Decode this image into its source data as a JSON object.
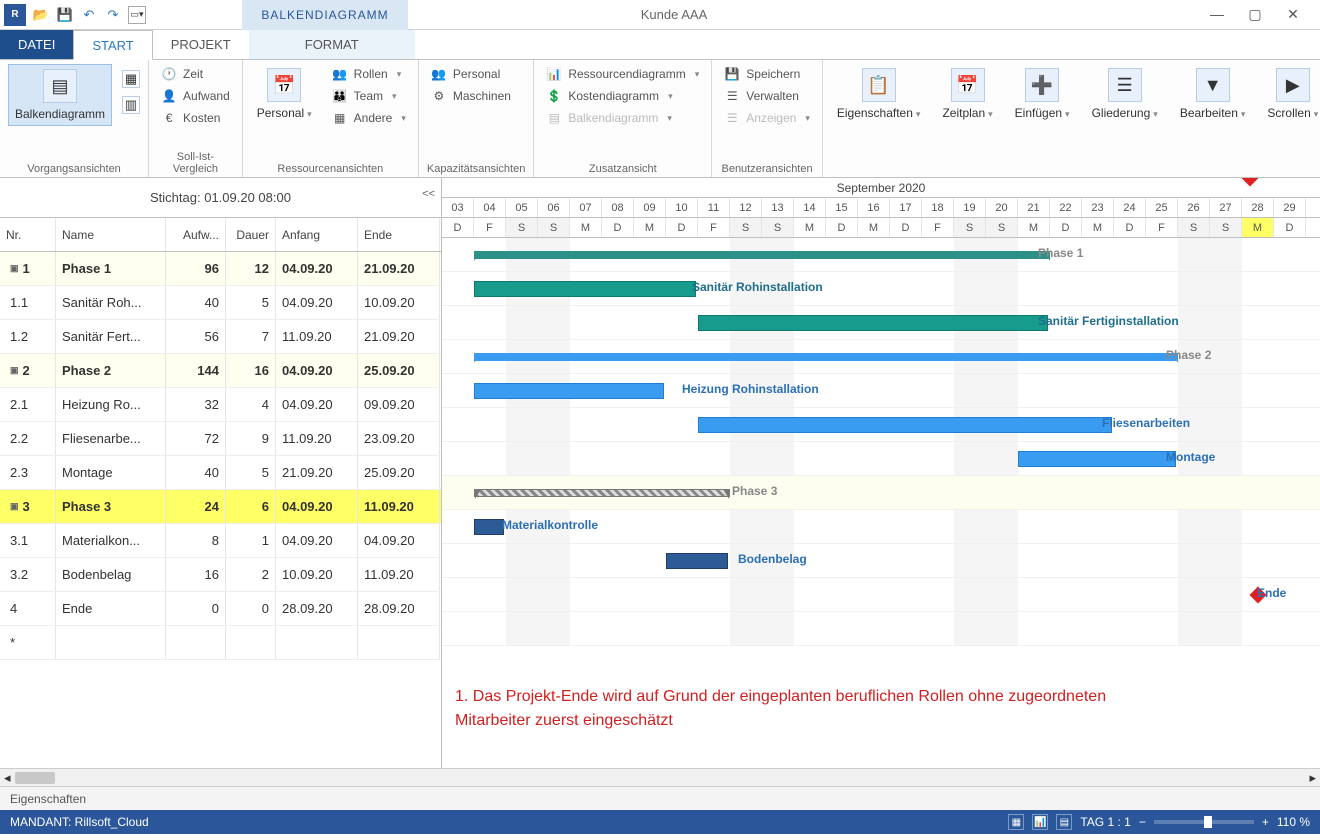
{
  "window": {
    "title": "Kunde AAA"
  },
  "context_tab": "BALKENDIAGRAMM",
  "tabs": {
    "file": "DATEI",
    "start": "START",
    "projekt": "PROJEKT",
    "format": "FORMAT"
  },
  "ribbon": {
    "g1": {
      "caption": "Vorgangsansichten",
      "big": "Balkendiagramm"
    },
    "g2": {
      "caption": "Soll-Ist-Vergleich",
      "items": [
        "Zeit",
        "Aufwand",
        "Kosten"
      ]
    },
    "g3": {
      "caption": "Ressourcenansichten",
      "big": "Personal",
      "items": [
        "Rollen",
        "Team",
        "Andere"
      ]
    },
    "g4": {
      "caption": "Kapazitätsansichten",
      "items": [
        "Personal",
        "Maschinen"
      ]
    },
    "g5": {
      "caption": "Zusatzansicht",
      "items": [
        "Ressourcendiagramm",
        "Kostendiagramm",
        "Balkendiagramm"
      ]
    },
    "g6": {
      "caption": "Benutzeransichten",
      "items": [
        "Speichern",
        "Verwalten",
        "Anzeigen"
      ]
    },
    "g7": [
      "Eigenschaften",
      "Zeitplan",
      "Einfügen",
      "Gliederung",
      "Bearbeiten",
      "Scrollen"
    ]
  },
  "stichtag": "Stichtag: 01.09.20 08:00",
  "collapse": "<<",
  "columns": {
    "nr": "Nr.",
    "name": "Name",
    "aufw": "Aufw...",
    "dauer": "Dauer",
    "anfang": "Anfang",
    "ende": "Ende"
  },
  "rows": [
    {
      "nr": "1",
      "name": "Phase 1",
      "aufw": "96",
      "dauer": "12",
      "anf": "04.09.20",
      "ende": "21.09.20",
      "cls": "ph1",
      "exp": true
    },
    {
      "nr": "1.1",
      "name": "Sanitär Roh...",
      "aufw": "40",
      "dauer": "5",
      "anf": "04.09.20",
      "ende": "10.09.20",
      "cls": ""
    },
    {
      "nr": "1.2",
      "name": "Sanitär Fert...",
      "aufw": "56",
      "dauer": "7",
      "anf": "11.09.20",
      "ende": "21.09.20",
      "cls": ""
    },
    {
      "nr": "2",
      "name": "Phase 2",
      "aufw": "144",
      "dauer": "16",
      "anf": "04.09.20",
      "ende": "25.09.20",
      "cls": "ph2",
      "exp": true
    },
    {
      "nr": "2.1",
      "name": "Heizung Ro...",
      "aufw": "32",
      "dauer": "4",
      "anf": "04.09.20",
      "ende": "09.09.20",
      "cls": ""
    },
    {
      "nr": "2.2",
      "name": "Fliesenarbe...",
      "aufw": "72",
      "dauer": "9",
      "anf": "11.09.20",
      "ende": "23.09.20",
      "cls": ""
    },
    {
      "nr": "2.3",
      "name": "Montage",
      "aufw": "40",
      "dauer": "5",
      "anf": "21.09.20",
      "ende": "25.09.20",
      "cls": ""
    },
    {
      "nr": "3",
      "name": "Phase 3",
      "aufw": "24",
      "dauer": "6",
      "anf": "04.09.20",
      "ende": "11.09.20",
      "cls": "ph3",
      "exp": true
    },
    {
      "nr": "3.1",
      "name": "Materialkon...",
      "aufw": "8",
      "dauer": "1",
      "anf": "04.09.20",
      "ende": "04.09.20",
      "cls": ""
    },
    {
      "nr": "3.2",
      "name": "Bodenbelag",
      "aufw": "16",
      "dauer": "2",
      "anf": "10.09.20",
      "ende": "11.09.20",
      "cls": ""
    },
    {
      "nr": "4",
      "name": "Ende",
      "aufw": "0",
      "dauer": "0",
      "anf": "28.09.20",
      "ende": "28.09.20",
      "cls": ""
    },
    {
      "nr": "*",
      "name": "",
      "aufw": "",
      "dauer": "",
      "anf": "",
      "ende": "",
      "cls": ""
    }
  ],
  "timeline": {
    "month": "September 2020",
    "days": [
      "03",
      "04",
      "05",
      "06",
      "07",
      "08",
      "09",
      "10",
      "11",
      "12",
      "13",
      "14",
      "15",
      "16",
      "17",
      "18",
      "19",
      "20",
      "21",
      "22",
      "23",
      "24",
      "25",
      "26",
      "27",
      "28",
      "29"
    ],
    "wd": [
      "D",
      "F",
      "S",
      "S",
      "M",
      "D",
      "M",
      "D",
      "F",
      "S",
      "S",
      "M",
      "D",
      "M",
      "D",
      "F",
      "S",
      "S",
      "M",
      "D",
      "M",
      "D",
      "F",
      "S",
      "S",
      "M",
      "D"
    ],
    "weekend_idx": [
      2,
      3,
      9,
      10,
      16,
      17,
      23,
      24
    ],
    "highlight_idx": 25
  },
  "gantt_labels": {
    "phase1": "Phase 1",
    "sanroh": "Sanitär Rohinstallation",
    "sanfert": "Sanitär Fertiginstallation",
    "phase2": "Phase 2",
    "heizroh": "Heizung Rohinstallation",
    "fliesen": "Fliesenarbeiten",
    "montage": "Montage",
    "phase3": "Phase 3",
    "matk": "Materialkontrolle",
    "boden": "Bodenbelag",
    "ende": "Ende"
  },
  "annotation": "1. Das Projekt-Ende wird auf Grund der eingeplanten beruflichen Rollen ohne zugeordneten Mitarbeiter zuerst eingeschätzt",
  "propbar": "Eigenschaften",
  "statusbar": {
    "mandant": "MANDANT: Rillsoft_Cloud",
    "tag": "TAG 1 : 1",
    "zoom": "110 %"
  },
  "chart_data": {
    "type": "gantt",
    "unit": "day",
    "x_start": "2020-09-03",
    "x_end": "2020-09-29",
    "tasks": [
      {
        "id": "1",
        "name": "Phase 1",
        "start": "2020-09-04",
        "end": "2020-09-21",
        "summary": true,
        "color": "#2d9088"
      },
      {
        "id": "1.1",
        "name": "Sanitär Rohinstallation",
        "start": "2020-09-04",
        "end": "2020-09-10",
        "summary": false,
        "color": "#169b8c"
      },
      {
        "id": "1.2",
        "name": "Sanitär Fertiginstallation",
        "start": "2020-09-11",
        "end": "2020-09-21",
        "summary": false,
        "color": "#169b8c"
      },
      {
        "id": "2",
        "name": "Phase 2",
        "start": "2020-09-04",
        "end": "2020-09-25",
        "summary": true,
        "color": "#3a9cf0"
      },
      {
        "id": "2.1",
        "name": "Heizung Rohinstallation",
        "start": "2020-09-04",
        "end": "2020-09-09",
        "summary": false,
        "color": "#3a9cf0"
      },
      {
        "id": "2.2",
        "name": "Fliesenarbeiten",
        "start": "2020-09-11",
        "end": "2020-09-23",
        "summary": false,
        "color": "#3a9cf0"
      },
      {
        "id": "2.3",
        "name": "Montage",
        "start": "2020-09-21",
        "end": "2020-09-25",
        "summary": false,
        "color": "#3a9cf0"
      },
      {
        "id": "3",
        "name": "Phase 3",
        "start": "2020-09-04",
        "end": "2020-09-11",
        "summary": true,
        "color": "#888888"
      },
      {
        "id": "3.1",
        "name": "Materialkontrolle",
        "start": "2020-09-04",
        "end": "2020-09-04",
        "summary": false,
        "color": "#2c5b96"
      },
      {
        "id": "3.2",
        "name": "Bodenbelag",
        "start": "2020-09-10",
        "end": "2020-09-11",
        "summary": false,
        "color": "#2c5b96"
      },
      {
        "id": "4",
        "name": "Ende",
        "start": "2020-09-28",
        "end": "2020-09-28",
        "milestone": true,
        "color": "#e02020"
      }
    ]
  }
}
